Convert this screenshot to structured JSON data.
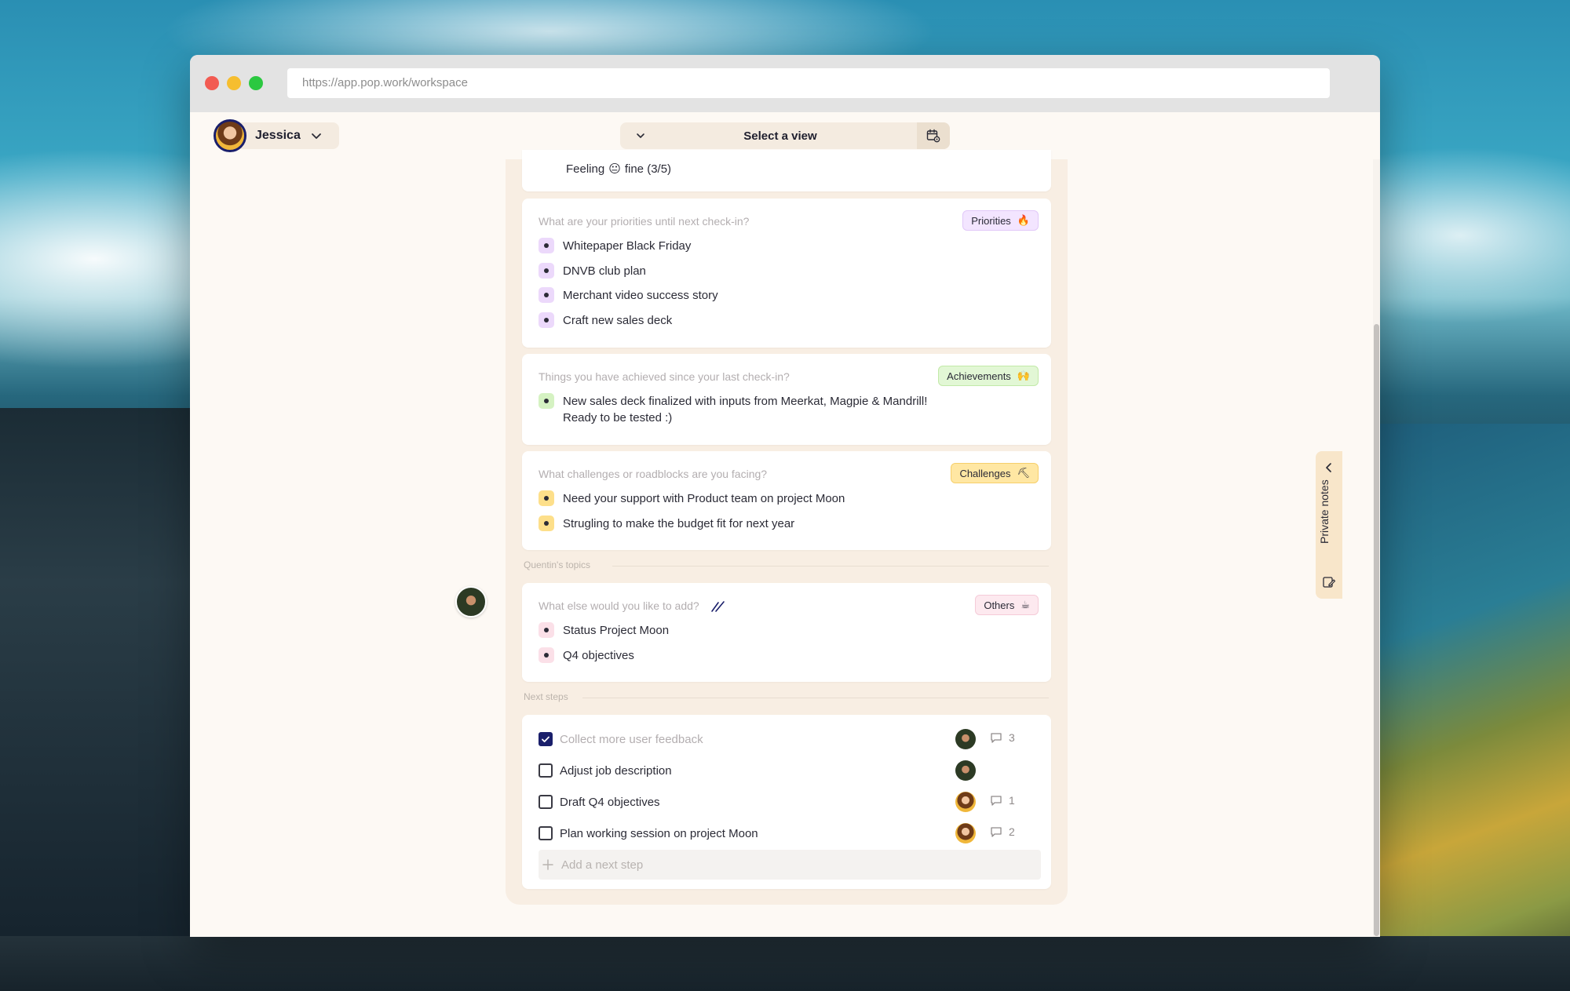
{
  "browser": {
    "url": "https://app.pop.work/workspace"
  },
  "header": {
    "user_name": "Jessica",
    "view_select_label": "Select a view"
  },
  "mood": {
    "text_before": "Feeling",
    "emoji": "😐",
    "text_after": "fine (3/5)"
  },
  "priorities": {
    "question": "What are your priorities until next check-in?",
    "tag": "Priorities",
    "tag_emoji": "🔥",
    "items": [
      "Whitepaper Black Friday",
      "DNVB club plan",
      "Merchant video success story",
      "Craft new sales deck"
    ]
  },
  "achievements": {
    "question": "Things you have achieved since your last check-in?",
    "tag": "Achievements",
    "tag_emoji": "🙌",
    "items": [
      "New sales deck finalized with inputs from Meerkat, Magpie & Mandrill!",
      "Ready to be tested :)"
    ]
  },
  "challenges": {
    "question": "What challenges or roadblocks are you facing?",
    "tag": "Challenges",
    "tag_emoji": "⛏",
    "items": [
      "Need your support with Product team on project Moon",
      "Strugling to make the budget fit for next year"
    ]
  },
  "quentin_topics": {
    "section_label": "Quentin's topics",
    "question": "What else would you like to add?",
    "tag": "Others",
    "tag_emoji": "☕",
    "items": [
      "Status Project Moon",
      "Q4 objectives"
    ]
  },
  "next_steps": {
    "section_label": "Next steps",
    "items": [
      {
        "label": "Collect more user feedback",
        "done": true,
        "assignee": "Quentin",
        "comments": "3"
      },
      {
        "label": "Adjust job description",
        "done": false,
        "assignee": "Quentin",
        "comments": ""
      },
      {
        "label": "Draft Q4 objectives",
        "done": false,
        "assignee": "Jessica",
        "comments": "1"
      },
      {
        "label": "Plan working session on project Moon",
        "done": false,
        "assignee": "Jessica",
        "comments": "2"
      }
    ],
    "add_placeholder": "Add a next step"
  },
  "private_notes": {
    "label": "Private notes"
  },
  "colors": {
    "accent_navy": "#1a1f6b",
    "panel_beige": "#f8eee3",
    "priorities_purple": "#ecd9fb",
    "achievements_green": "#d5f2c2",
    "challenges_yellow": "#fddf8a",
    "others_pink": "#fbe0e8"
  }
}
